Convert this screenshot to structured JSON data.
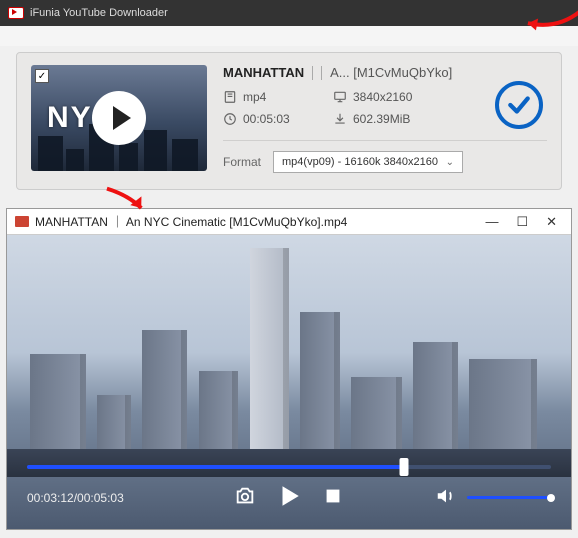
{
  "app": {
    "title": "iFunia YouTube Downloader"
  },
  "download": {
    "checked": true,
    "thumb_text": "NYC",
    "title_primary": "MANHATTAN",
    "title_secondary": "A... [M1CvMuQbYko]",
    "specs": {
      "container": "mp4",
      "resolution": "3840x2160",
      "duration": "00:05:03",
      "size": "602.39MiB"
    },
    "format_label": "Format",
    "format_selected": "mp4(vp09) - 16160k 3840x2160",
    "status": "complete"
  },
  "player": {
    "window_title": "MANHATTAN ｜ An NYC Cinematic [M1CvMuQbYko].mp4",
    "current_time": "00:03:12",
    "total_time": "00:05:03",
    "time_display": "00:03:12/00:05:03",
    "progress_pct": 72,
    "volume_pct": 100
  }
}
